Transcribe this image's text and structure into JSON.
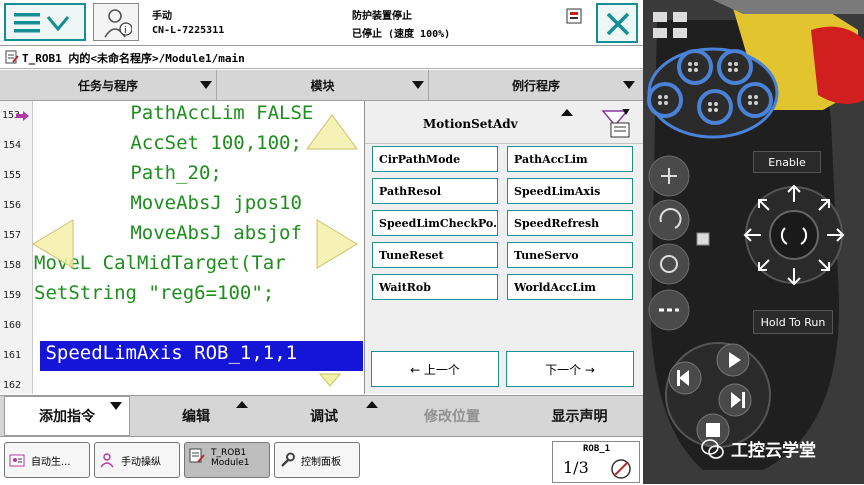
{
  "header": {
    "mode": "手动",
    "controller": "CN-L-7225311",
    "safety": "防护装置停止",
    "state": "已停止 (速度 100%)"
  },
  "path": "T_ROB1 内的<未命名程序>/Module1/main",
  "tabs": [
    {
      "label": "任务与程序"
    },
    {
      "label": "模块"
    },
    {
      "label": "例行程序"
    }
  ],
  "editor": {
    "lines": [
      {
        "num": "153",
        "code": "   PathAccLim FALSE"
      },
      {
        "num": "154",
        "code": "   AccSet 100,100;"
      },
      {
        "num": "155",
        "code": "   Path_20;"
      },
      {
        "num": "156",
        "code": "   MoveAbsJ jpos10"
      },
      {
        "num": "157",
        "code": "   MoveAbsJ absjof"
      },
      {
        "num": "158",
        "code": "MoveL CalMidTarget(Tar"
      },
      {
        "num": "159",
        "code": "SetString \"reg6=100\";"
      },
      {
        "num": "160",
        "code": ""
      },
      {
        "num": "161",
        "code": " SpeedLimAxis ROB_1,1,1"
      },
      {
        "num": "162",
        "code": ""
      }
    ]
  },
  "panel": {
    "title": "MotionSetAdv",
    "items": [
      "CirPathMode",
      "PathAccLim",
      "PathResol",
      "SpeedLimAxis",
      "SpeedLimCheckPo.",
      "SpeedRefresh",
      "TuneReset",
      "TuneServo",
      "WaitRob",
      "WorldAccLim"
    ],
    "prev": "← 上一个",
    "next": "下一个 →"
  },
  "toolbar": [
    {
      "label": "添加指令"
    },
    {
      "label": "编辑"
    },
    {
      "label": "调试"
    },
    {
      "label": "修改位置"
    },
    {
      "label": "显示声明"
    }
  ],
  "taskbar": [
    {
      "label": "自动生..."
    },
    {
      "label": "手动操纵"
    },
    {
      "label": "T_ROB1",
      "sub": "Module1"
    },
    {
      "label": "控制面板"
    }
  ],
  "robot_status": {
    "name": "ROB_1",
    "fraction": "1/3"
  },
  "hardware": {
    "enable": "Enable",
    "hold": "Hold To Run"
  },
  "watermark": "工控云学堂",
  "colors": {
    "accent": "#148f96",
    "code": "#1e8e1e",
    "selection": "#1515d8",
    "panel_btn": "#4a82d8"
  }
}
